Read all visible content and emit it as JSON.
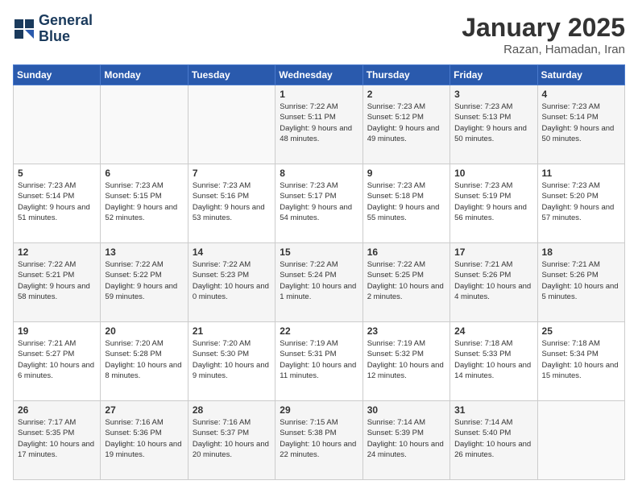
{
  "logo": {
    "line1": "General",
    "line2": "Blue"
  },
  "header": {
    "title": "January 2025",
    "subtitle": "Razan, Hamadan, Iran"
  },
  "weekdays": [
    "Sunday",
    "Monday",
    "Tuesday",
    "Wednesday",
    "Thursday",
    "Friday",
    "Saturday"
  ],
  "weeks": [
    [
      {
        "day": "",
        "info": ""
      },
      {
        "day": "",
        "info": ""
      },
      {
        "day": "",
        "info": ""
      },
      {
        "day": "1",
        "info": "Sunrise: 7:22 AM\nSunset: 5:11 PM\nDaylight: 9 hours\nand 48 minutes."
      },
      {
        "day": "2",
        "info": "Sunrise: 7:23 AM\nSunset: 5:12 PM\nDaylight: 9 hours\nand 49 minutes."
      },
      {
        "day": "3",
        "info": "Sunrise: 7:23 AM\nSunset: 5:13 PM\nDaylight: 9 hours\nand 50 minutes."
      },
      {
        "day": "4",
        "info": "Sunrise: 7:23 AM\nSunset: 5:14 PM\nDaylight: 9 hours\nand 50 minutes."
      }
    ],
    [
      {
        "day": "5",
        "info": "Sunrise: 7:23 AM\nSunset: 5:14 PM\nDaylight: 9 hours\nand 51 minutes."
      },
      {
        "day": "6",
        "info": "Sunrise: 7:23 AM\nSunset: 5:15 PM\nDaylight: 9 hours\nand 52 minutes."
      },
      {
        "day": "7",
        "info": "Sunrise: 7:23 AM\nSunset: 5:16 PM\nDaylight: 9 hours\nand 53 minutes."
      },
      {
        "day": "8",
        "info": "Sunrise: 7:23 AM\nSunset: 5:17 PM\nDaylight: 9 hours\nand 54 minutes."
      },
      {
        "day": "9",
        "info": "Sunrise: 7:23 AM\nSunset: 5:18 PM\nDaylight: 9 hours\nand 55 minutes."
      },
      {
        "day": "10",
        "info": "Sunrise: 7:23 AM\nSunset: 5:19 PM\nDaylight: 9 hours\nand 56 minutes."
      },
      {
        "day": "11",
        "info": "Sunrise: 7:23 AM\nSunset: 5:20 PM\nDaylight: 9 hours\nand 57 minutes."
      }
    ],
    [
      {
        "day": "12",
        "info": "Sunrise: 7:22 AM\nSunset: 5:21 PM\nDaylight: 9 hours\nand 58 minutes."
      },
      {
        "day": "13",
        "info": "Sunrise: 7:22 AM\nSunset: 5:22 PM\nDaylight: 9 hours\nand 59 minutes."
      },
      {
        "day": "14",
        "info": "Sunrise: 7:22 AM\nSunset: 5:23 PM\nDaylight: 10 hours\nand 0 minutes."
      },
      {
        "day": "15",
        "info": "Sunrise: 7:22 AM\nSunset: 5:24 PM\nDaylight: 10 hours\nand 1 minute."
      },
      {
        "day": "16",
        "info": "Sunrise: 7:22 AM\nSunset: 5:25 PM\nDaylight: 10 hours\nand 2 minutes."
      },
      {
        "day": "17",
        "info": "Sunrise: 7:21 AM\nSunset: 5:26 PM\nDaylight: 10 hours\nand 4 minutes."
      },
      {
        "day": "18",
        "info": "Sunrise: 7:21 AM\nSunset: 5:26 PM\nDaylight: 10 hours\nand 5 minutes."
      }
    ],
    [
      {
        "day": "19",
        "info": "Sunrise: 7:21 AM\nSunset: 5:27 PM\nDaylight: 10 hours\nand 6 minutes."
      },
      {
        "day": "20",
        "info": "Sunrise: 7:20 AM\nSunset: 5:28 PM\nDaylight: 10 hours\nand 8 minutes."
      },
      {
        "day": "21",
        "info": "Sunrise: 7:20 AM\nSunset: 5:30 PM\nDaylight: 10 hours\nand 9 minutes."
      },
      {
        "day": "22",
        "info": "Sunrise: 7:19 AM\nSunset: 5:31 PM\nDaylight: 10 hours\nand 11 minutes."
      },
      {
        "day": "23",
        "info": "Sunrise: 7:19 AM\nSunset: 5:32 PM\nDaylight: 10 hours\nand 12 minutes."
      },
      {
        "day": "24",
        "info": "Sunrise: 7:18 AM\nSunset: 5:33 PM\nDaylight: 10 hours\nand 14 minutes."
      },
      {
        "day": "25",
        "info": "Sunrise: 7:18 AM\nSunset: 5:34 PM\nDaylight: 10 hours\nand 15 minutes."
      }
    ],
    [
      {
        "day": "26",
        "info": "Sunrise: 7:17 AM\nSunset: 5:35 PM\nDaylight: 10 hours\nand 17 minutes."
      },
      {
        "day": "27",
        "info": "Sunrise: 7:16 AM\nSunset: 5:36 PM\nDaylight: 10 hours\nand 19 minutes."
      },
      {
        "day": "28",
        "info": "Sunrise: 7:16 AM\nSunset: 5:37 PM\nDaylight: 10 hours\nand 20 minutes."
      },
      {
        "day": "29",
        "info": "Sunrise: 7:15 AM\nSunset: 5:38 PM\nDaylight: 10 hours\nand 22 minutes."
      },
      {
        "day": "30",
        "info": "Sunrise: 7:14 AM\nSunset: 5:39 PM\nDaylight: 10 hours\nand 24 minutes."
      },
      {
        "day": "31",
        "info": "Sunrise: 7:14 AM\nSunset: 5:40 PM\nDaylight: 10 hours\nand 26 minutes."
      },
      {
        "day": "",
        "info": ""
      }
    ]
  ]
}
